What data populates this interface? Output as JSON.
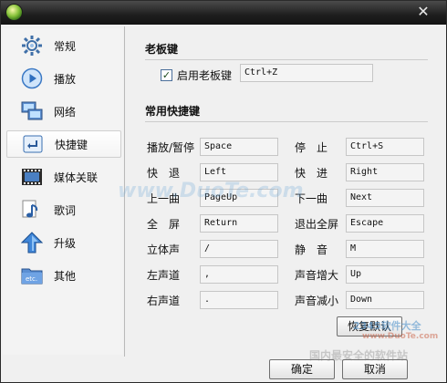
{
  "sidebar": {
    "items": [
      {
        "label": "常规",
        "icon": "gear-icon"
      },
      {
        "label": "播放",
        "icon": "play-icon"
      },
      {
        "label": "网络",
        "icon": "network-icon"
      },
      {
        "label": "快捷键",
        "icon": "shortcut-icon",
        "selected": true
      },
      {
        "label": "媒体关联",
        "icon": "film-icon"
      },
      {
        "label": "歌词",
        "icon": "music-note-icon"
      },
      {
        "label": "升级",
        "icon": "upgrade-arrow-icon"
      },
      {
        "label": "其他",
        "icon": "etc-folder-icon"
      }
    ]
  },
  "boss_key": {
    "title": "老板键",
    "enable_label": "启用老板键",
    "enabled": true,
    "value": "Ctrl+Z"
  },
  "shortcuts": {
    "title": "常用快捷键",
    "left": [
      {
        "label": "播放/暂停",
        "value": "Space"
      },
      {
        "label": "快　退",
        "value": "Left"
      },
      {
        "label": "上一曲",
        "value": "PageUp"
      },
      {
        "label": "全　屏",
        "value": "Return"
      },
      {
        "label": "立体声",
        "value": "/"
      },
      {
        "label": "左声道",
        "value": ","
      },
      {
        "label": "右声道",
        "value": "."
      }
    ],
    "right": [
      {
        "label": "停　止",
        "value": "Ctrl+S"
      },
      {
        "label": "快　进",
        "value": "Right"
      },
      {
        "label": "下一曲",
        "value": "Next"
      },
      {
        "label": "退出全屏",
        "value": "Escape"
      },
      {
        "label": "静　音",
        "value": "M"
      },
      {
        "label": "声音增大",
        "value": "Up"
      },
      {
        "label": "声音减小",
        "value": "Down"
      }
    ]
  },
  "buttons": {
    "restore_default": "恢复默认",
    "ok": "确定",
    "cancel": "取消"
  },
  "watermarks": {
    "center": "www.DuoTe.com",
    "corner_brand": "2345软件大全",
    "corner_url": "www.DuoTe.com",
    "corner_slogan": "国内最安全的软件站"
  },
  "colors": {
    "titlebar": "#1e1e1e",
    "selected_item_bg": "#ffffff",
    "field_bg": "#f4f4f4"
  }
}
